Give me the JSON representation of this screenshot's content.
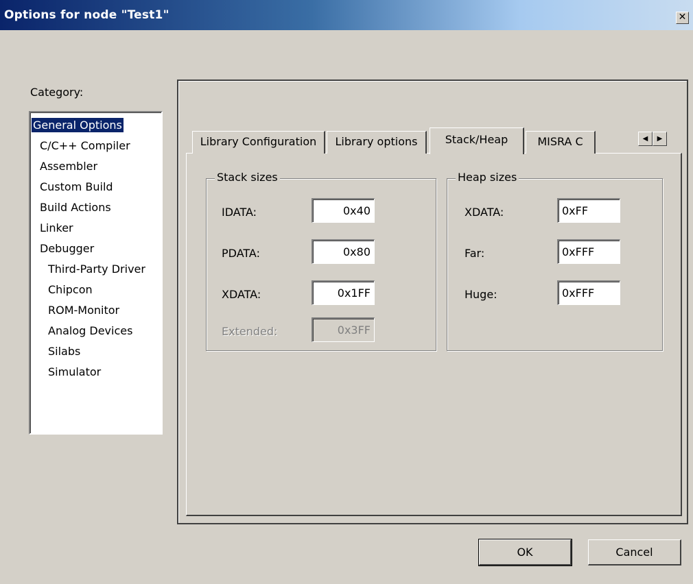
{
  "window": {
    "title": "Options for node \"Test1\"",
    "close_glyph": "✕"
  },
  "category": {
    "label": "Category:",
    "items": [
      {
        "label": "General Options"
      },
      {
        "label": "C/C++ Compiler"
      },
      {
        "label": "Assembler"
      },
      {
        "label": "Custom Build"
      },
      {
        "label": "Build Actions"
      },
      {
        "label": "Linker"
      },
      {
        "label": "Debugger"
      },
      {
        "label": "Third-Party Driver"
      },
      {
        "label": "Chipcon"
      },
      {
        "label": "ROM-Monitor"
      },
      {
        "label": "Analog Devices"
      },
      {
        "label": "Silabs"
      },
      {
        "label": "Simulator"
      }
    ],
    "selected": "General Options"
  },
  "tabs": [
    {
      "label": "Library Configuration"
    },
    {
      "label": "Library options"
    },
    {
      "label": "Stack/Heap"
    },
    {
      "label": "MISRA C"
    }
  ],
  "active_tab": "Stack/Heap",
  "tab_scroll": {
    "left_glyph": "◀",
    "right_glyph": "▶"
  },
  "stack_sizes": {
    "title": "Stack sizes",
    "fields": [
      {
        "label": "IDATA:",
        "value": "0x40"
      },
      {
        "label": "PDATA:",
        "value": "0x80"
      },
      {
        "label": "XDATA:",
        "value": "0x1FF"
      },
      {
        "label": "Extended:",
        "value": "0x3FF"
      }
    ]
  },
  "heap_sizes": {
    "title": "Heap sizes",
    "fields": [
      {
        "label": "XDATA:",
        "value": "0xFF"
      },
      {
        "label": "Far:",
        "value": "0xFFF"
      },
      {
        "label": "Huge:",
        "value": "0xFFF"
      }
    ]
  },
  "buttons": {
    "ok": "OK",
    "cancel": "Cancel"
  }
}
